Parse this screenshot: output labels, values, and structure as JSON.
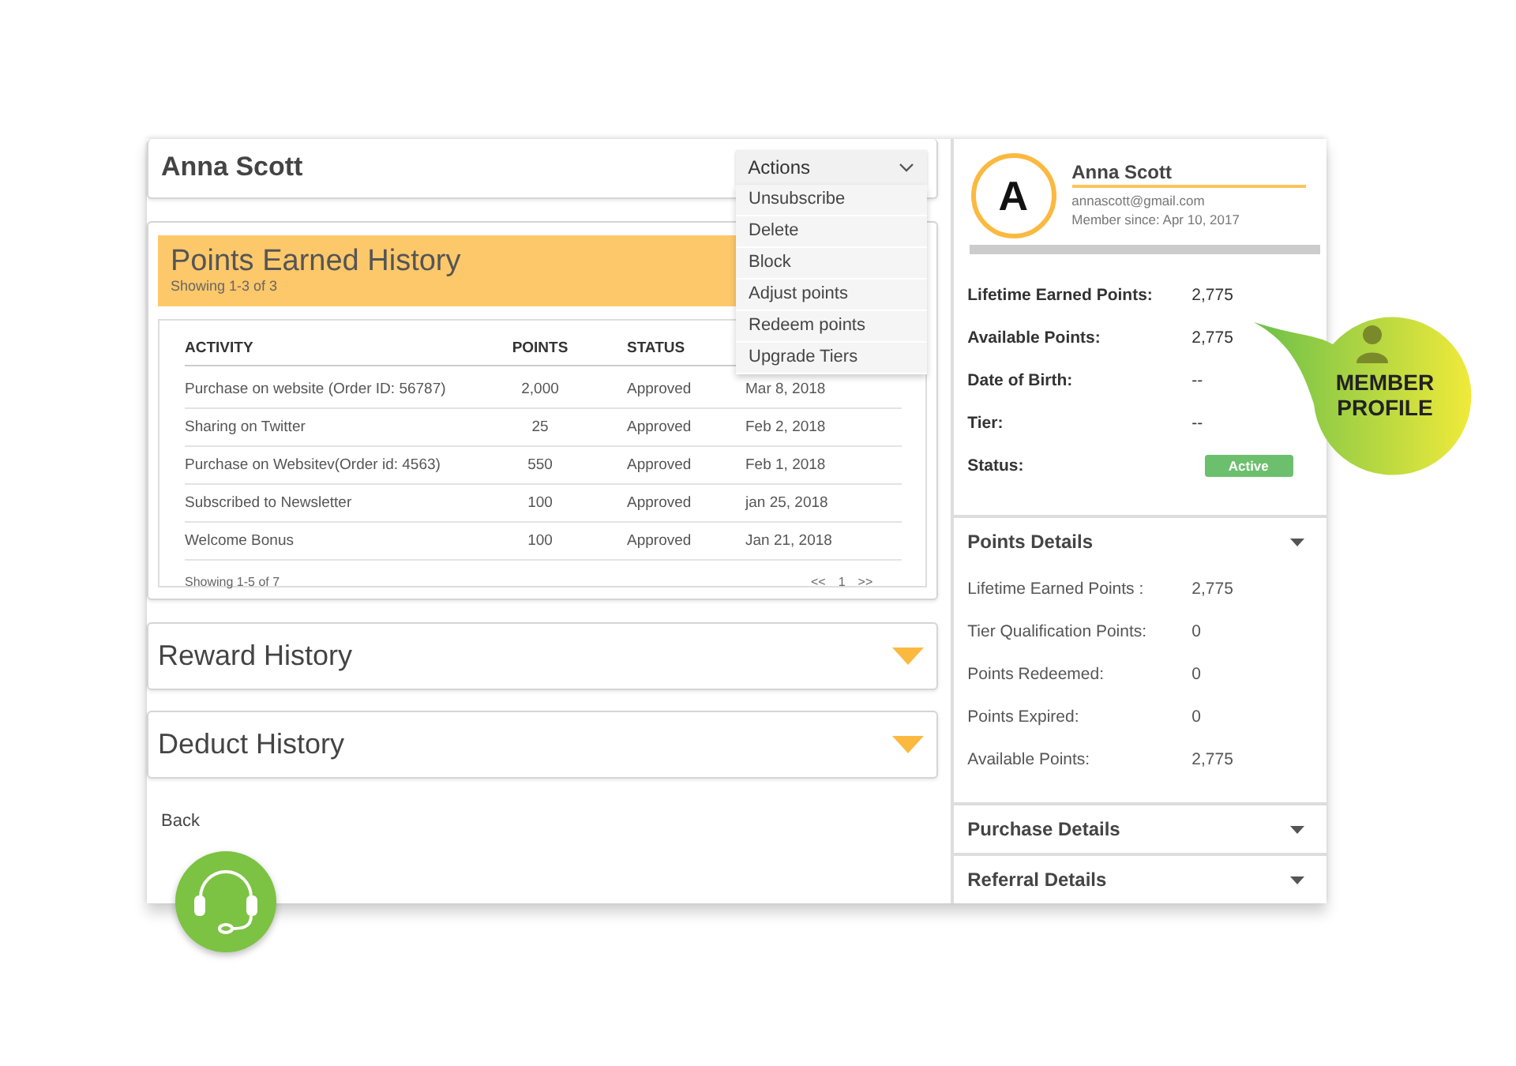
{
  "member_name": "Anna Scott",
  "actions": {
    "label": "Actions",
    "open": true,
    "items": [
      "Unsubscribe",
      "Delete",
      "Block",
      "Adjust points",
      "Redeem points",
      "Upgrade Tiers"
    ]
  },
  "points_history": {
    "title": "Points Earned History",
    "subtitle": "Showing 1-3 of 3",
    "columns": [
      "ACTIVITY",
      "POINTS",
      "STATUS"
    ],
    "rows": [
      {
        "activity": "Purchase on website (Order ID: 56787)",
        "points": "2,000",
        "status": "Approved",
        "column_4": "Mar 8, 2018"
      },
      {
        "activity": "Sharing on Twitter",
        "points": "25",
        "status": "Approved",
        "column_4": "Feb 2, 2018"
      },
      {
        "activity": "Purchase on Websitev(Order id: 4563)",
        "points": "550",
        "status": "Approved",
        "column_4": "Feb 1, 2018"
      },
      {
        "activity": "Subscribed to Newsletter",
        "points": "100",
        "status": "Approved",
        "column_4": "jan 25, 2018"
      },
      {
        "activity": "Welcome Bonus",
        "points": "100",
        "status": "Approved",
        "column_4": "Jan 21, 2018"
      }
    ],
    "footer": "Showing 1-5 of 7",
    "pager": {
      "prev": "<<",
      "page": "1",
      "next": ">>"
    }
  },
  "collapsed_sections": [
    "Reward History",
    "Deduct History"
  ],
  "back_link": "Back",
  "profile": {
    "initial": "A",
    "name": "Anna Scott",
    "email": "annascott@gmail.com",
    "member_since": "Member since: Apr 10, 2017",
    "fields": [
      {
        "label": "Lifetime Earned Points:",
        "value": "2,775",
        "kind": "text"
      },
      {
        "label": "Available Points:",
        "value": "2,775",
        "kind": "text"
      },
      {
        "label": "Date of Birth:",
        "value": "--",
        "kind": "text"
      },
      {
        "label": "Tier:",
        "value": "--",
        "kind": "text"
      },
      {
        "label": "Status:",
        "value": "Active",
        "kind": "badge"
      }
    ]
  },
  "points_details": {
    "title": "Points Details",
    "items": [
      {
        "label": "Lifetime Earned Points :",
        "value": "2,775"
      },
      {
        "label": "Tier Qualification Points:",
        "value": "0"
      },
      {
        "label": "Points Redeemed:",
        "value": "0"
      },
      {
        "label": "Points Expired:",
        "value": "0"
      },
      {
        "label": "Available Points:",
        "value": "2,775"
      }
    ]
  },
  "other_sections": [
    "Purchase Details",
    "Referral Details"
  ],
  "promo_badge": {
    "label": "MEMBER PROFILE"
  }
}
